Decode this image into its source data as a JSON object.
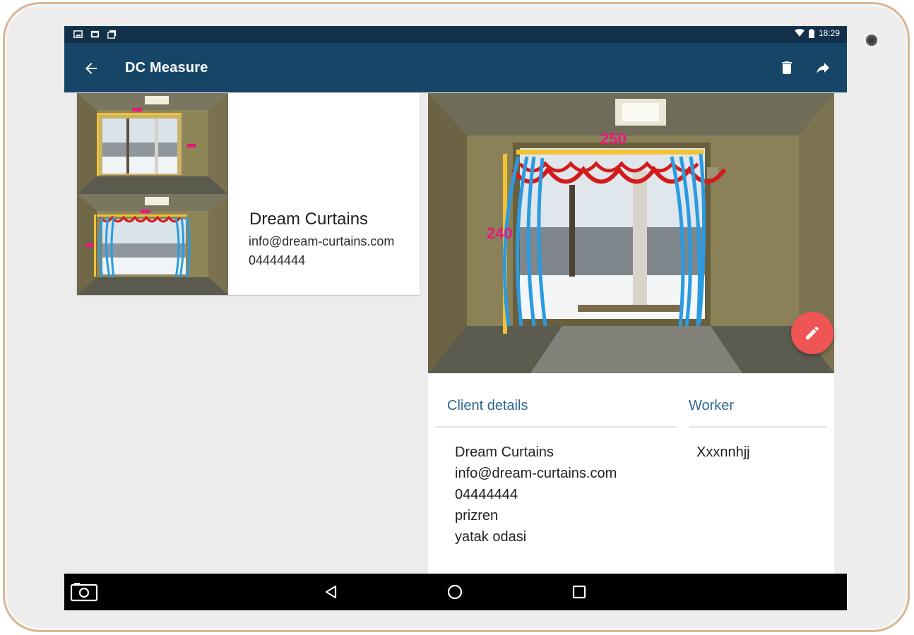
{
  "status_bar": {
    "time": "18:29",
    "left_icons": [
      "image-notification-icon",
      "photo-notification-icon",
      "photos-stack-icon"
    ],
    "right_icons": [
      "wifi-icon",
      "battery-icon"
    ]
  },
  "app_bar": {
    "title": "DC Measure",
    "actions": [
      "delete-icon",
      "share-icon"
    ]
  },
  "list_card": {
    "name": "Dream Curtains",
    "email": "info@dream-curtains.com",
    "phone": "04444444"
  },
  "measurement_photo": {
    "width_label": "250",
    "height_label": "240"
  },
  "details": {
    "client_heading": "Client details",
    "worker_heading": "Worker",
    "client_lines": [
      "Dream Curtains",
      "info@dream-curtains.com",
      "04444444",
      "prizren",
      "yatak odasi"
    ],
    "worker_name": "Xxxnnhjj"
  },
  "nav_bar": {
    "buttons": [
      "screenshot-icon",
      "back-triangle-icon",
      "home-circle-icon",
      "recents-square-icon"
    ]
  },
  "colors": {
    "status_bar": "#12304a",
    "app_bar": "#174568",
    "accent_heading": "#2e6790",
    "fab": "#ef5555",
    "tablet_frame": "#d9b795"
  }
}
